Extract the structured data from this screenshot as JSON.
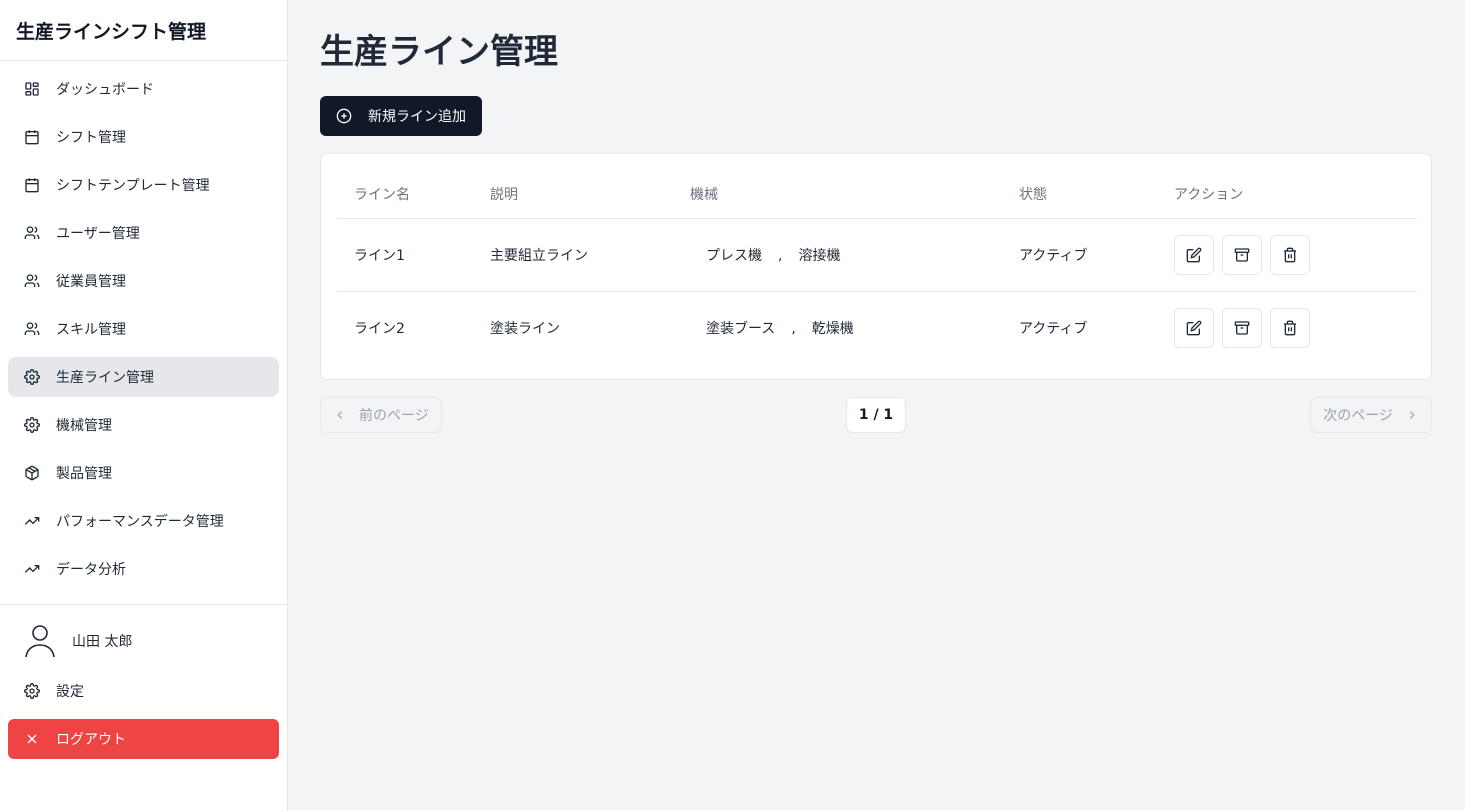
{
  "app": {
    "title": "生産ラインシフト管理"
  },
  "sidebar": {
    "items": [
      {
        "label": "ダッシュボード",
        "icon": "dashboard-icon"
      },
      {
        "label": "シフト管理",
        "icon": "calendar-icon"
      },
      {
        "label": "シフトテンプレート管理",
        "icon": "calendar-icon"
      },
      {
        "label": "ユーザー管理",
        "icon": "users-icon"
      },
      {
        "label": "従業員管理",
        "icon": "users-icon"
      },
      {
        "label": "スキル管理",
        "icon": "users-icon"
      },
      {
        "label": "生産ライン管理",
        "icon": "gear-icon",
        "active": true
      },
      {
        "label": "機械管理",
        "icon": "gear-icon"
      },
      {
        "label": "製品管理",
        "icon": "box-icon"
      },
      {
        "label": "パフォーマンスデータ管理",
        "icon": "trending-up-icon"
      },
      {
        "label": "データ分析",
        "icon": "trending-up-icon"
      }
    ],
    "user_name": "山田 太郎",
    "settings_label": "設定",
    "logout_label": "ログアウト"
  },
  "main": {
    "title": "生産ライン管理",
    "add_button_label": "新規ライン追加",
    "table": {
      "headers": [
        "ライン名",
        "説明",
        "機械",
        "状態",
        "アクション"
      ],
      "rows": [
        {
          "name": "ライン1",
          "description": "主要組立ライン",
          "machines": [
            "プレス機",
            "溶接機"
          ],
          "status": "アクティブ"
        },
        {
          "name": "ライン2",
          "description": "塗装ライン",
          "machines": [
            "塗装ブース",
            "乾燥機"
          ],
          "status": "アクティブ"
        }
      ],
      "machine_separator": ","
    },
    "pagination": {
      "prev_label": "前のページ",
      "page_indicator": "1 / 1",
      "next_label": "次のページ"
    }
  },
  "colors": {
    "sidebar_bg": "#ffffff",
    "main_bg": "#f3f4f6",
    "primary_button": "#111827",
    "logout_button": "#ef4444",
    "active_nav_bg": "#e5e7eb"
  }
}
